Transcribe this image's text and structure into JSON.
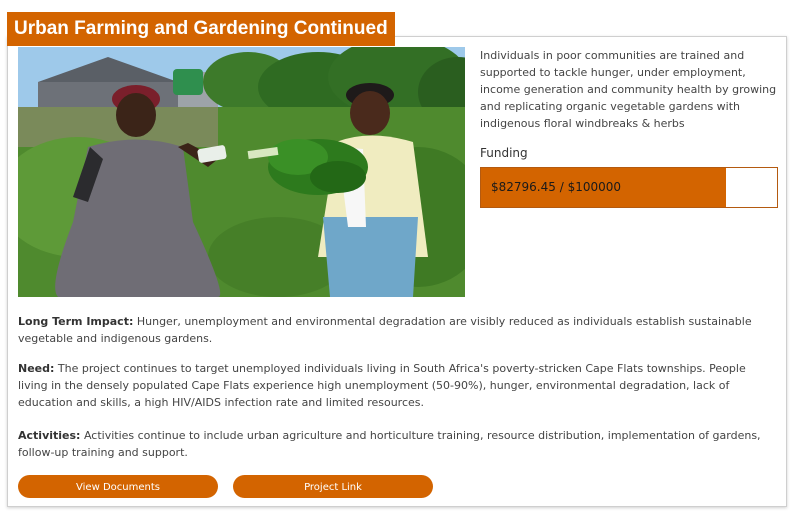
{
  "title": "Urban Farming and Gardening Continued",
  "description": "Individuals in poor communities are trained and supported to tackle hunger, under employment, income generation and community health by growing and replicating organic vegetable gardens with indigenous floral windbreaks & herbs",
  "funding": {
    "label": "Funding",
    "text": "$82796.45 / $100000",
    "raised": 82796.45,
    "goal": 100000,
    "progress_fraction": 0.828
  },
  "sections": {
    "long_term_impact": {
      "label": "Long Term Impact:",
      "text": " Hunger, unemployment and environmental degradation are visibly reduced as individuals establish sustainable vegetable and indigenous gardens."
    },
    "need": {
      "label": "Need:",
      "text": " The project continues to target unemployed individuals living in South Africa's poverty-stricken Cape Flats townships. People living in the densely populated Cape Flats experience high unemployment (50-90%), hunger, environmental degradation, lack of education and skills, a high HIV/AIDS infection rate and limited resources."
    },
    "activities": {
      "label": "Activities:",
      "text": " Activities continue to include urban agriculture and horticulture training, resource distribution, implementation of gardens, follow-up training and support."
    }
  },
  "buttons": {
    "documents": "View Documents",
    "project_link": "Project Link"
  },
  "colors": {
    "accent": "#d36400",
    "border": "#cfcfcf"
  }
}
